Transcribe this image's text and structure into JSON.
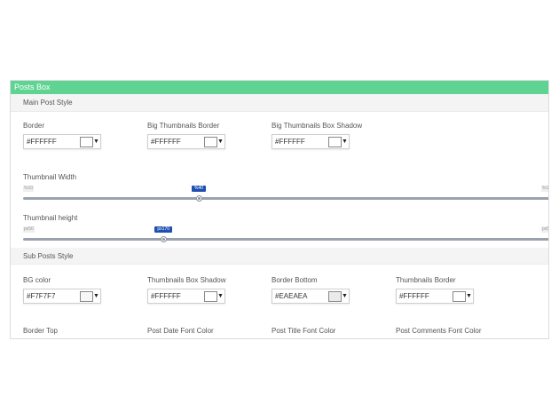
{
  "panel": {
    "title": "Posts Box"
  },
  "main_section": {
    "title": "Main Post Style",
    "fields": [
      {
        "label": "Border",
        "value": "#FFFFFF",
        "swatch": "#FFFFFF"
      },
      {
        "label": "Big Thumbnails Border",
        "value": "#FFFFFF",
        "swatch": "#FFFFFF"
      },
      {
        "label": "Big Thumbnails Box Shadow",
        "value": "#FFFFFF",
        "swatch": "#FFFFFF"
      }
    ],
    "sliders": [
      {
        "label": "Thumbnail Width",
        "min_label": "%10",
        "max_label": "%1",
        "value_label": "%40",
        "value": 40,
        "min": 10,
        "max": 100
      },
      {
        "label": "Thumbnail height",
        "min_label": "px50",
        "max_label": "px5",
        "value_label": "px170",
        "value": 170,
        "min": 50,
        "max": 500
      }
    ]
  },
  "sub_section": {
    "title": "Sub Posts Style",
    "fields": [
      {
        "label": "BG color",
        "value": "#F7F7F7",
        "swatch": "#F7F7F7"
      },
      {
        "label": "Thumbnails Box Shadow",
        "value": "#FFFFFF",
        "swatch": "#FFFFFF"
      },
      {
        "label": "Border Bottom",
        "value": "#EAEAEA",
        "swatch": "#EAEAEA"
      },
      {
        "label": "Thumbnails Border",
        "value": "#FFFFFF",
        "swatch": "#FFFFFF"
      }
    ],
    "bottom_labels": [
      "Border Top",
      "Post Date Font Color",
      "Post Title Font Color",
      "Post Comments Font Color"
    ]
  },
  "colors": {
    "header": "#5fd391",
    "slider_bubble": "#1f4fb0"
  },
  "icons": {
    "dropdown": "caret-down-icon"
  }
}
